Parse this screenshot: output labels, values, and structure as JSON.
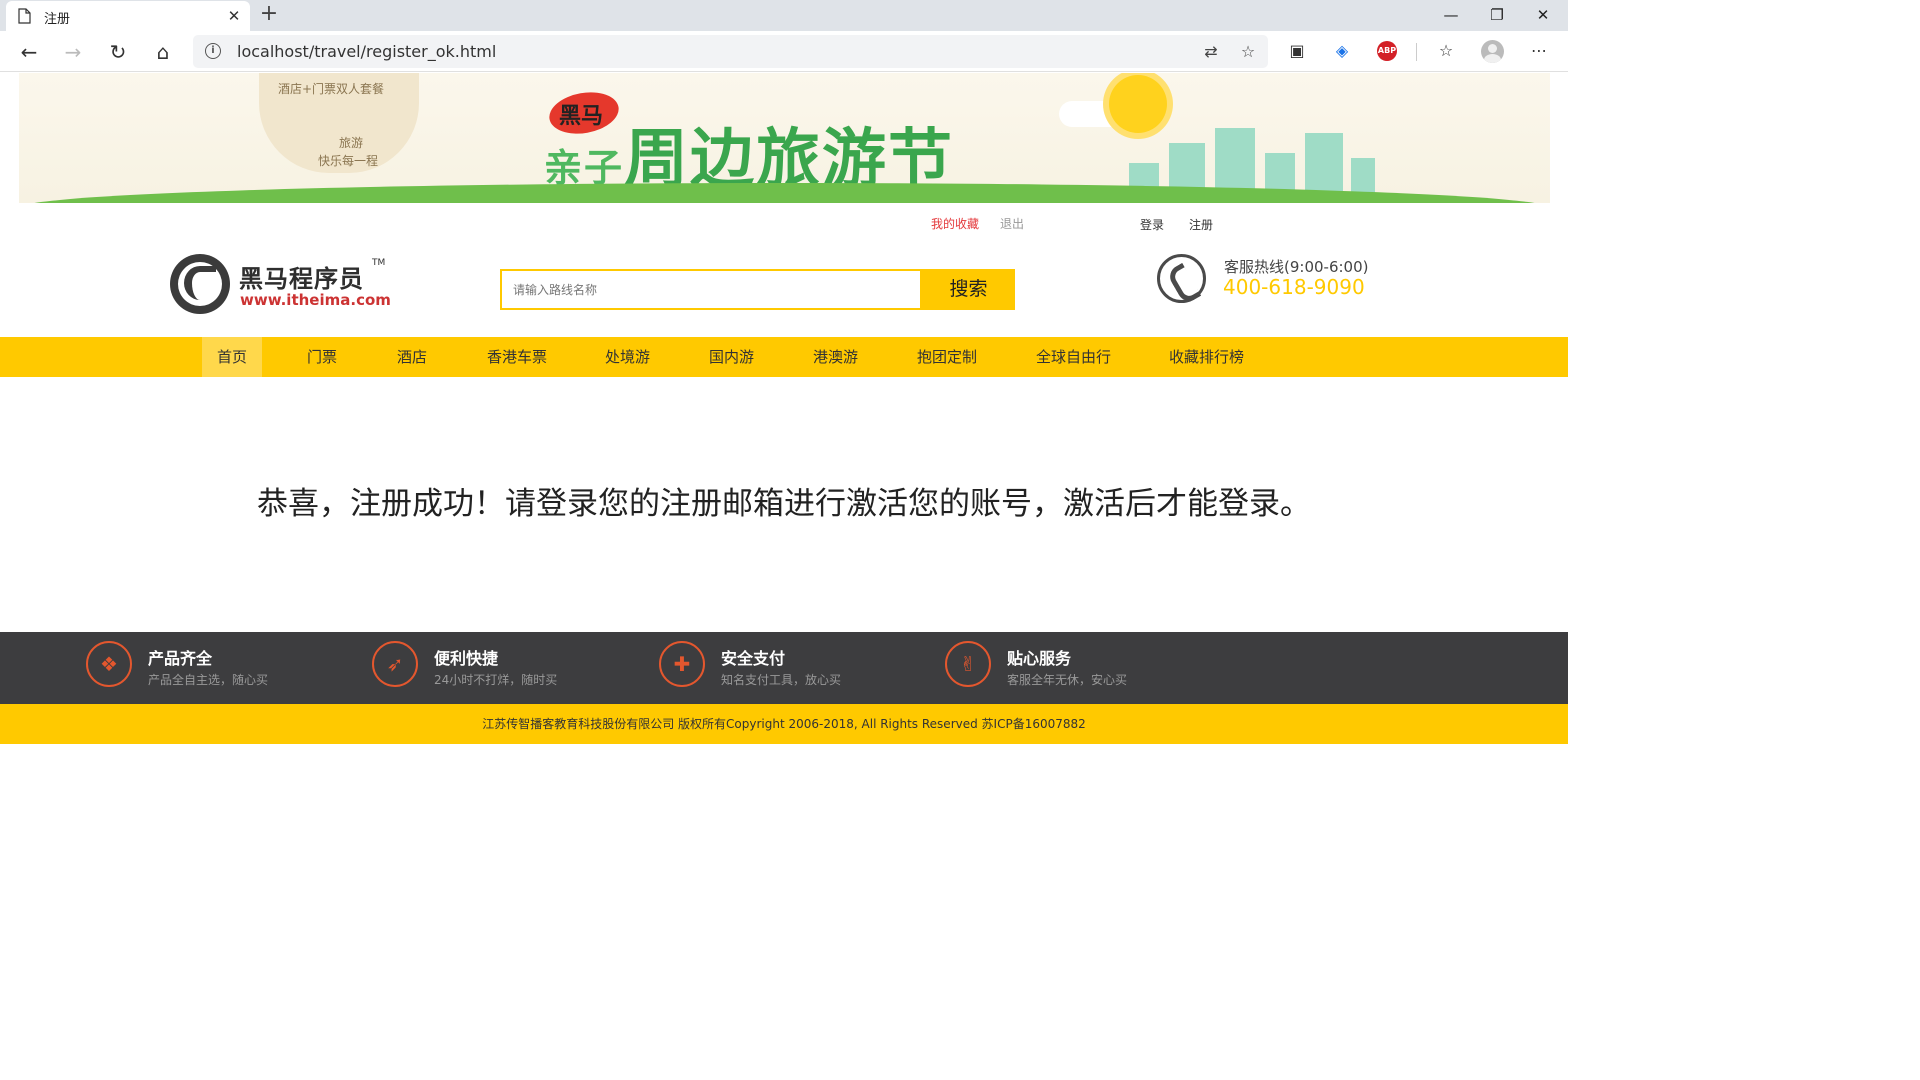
{
  "browser": {
    "tab_title": "注册",
    "url": "localhost/travel/register_ok.html",
    "new_tab_symbol": "+",
    "minimize_symbol": "—",
    "restore_symbol": "❐",
    "close_symbol": "✕",
    "tab_close_symbol": "✕",
    "back_symbol": "←",
    "forward_symbol": "→",
    "reload_symbol": "↻",
    "home_symbol": "⌂",
    "translate_symbol": "⇄",
    "favorite_symbol": "☆",
    "collections_symbol": "▣",
    "extension_symbol": "◈",
    "abp_label": "ABP",
    "favorites_bar_symbol": "☆",
    "more_symbol": "⋯",
    "info_symbol": "i"
  },
  "banner": {
    "bag_line1": "酒店+门票双人套餐",
    "bag_line2": "旅游",
    "bag_line3": "快乐每一程",
    "brand_badge": "黑马",
    "festival_prefix": "亲子",
    "festival_title": "周边旅游节"
  },
  "header": {
    "my_favorites": "我的收藏",
    "logout": "退出",
    "login": "登录",
    "register": "注册",
    "logo_cn": "黑马程序员",
    "logo_tm": "TM",
    "logo_en": "www.itheima.com",
    "search_placeholder": "请输入路线名称",
    "search_button": "搜索",
    "hotline_label": "客服热线(9:00-6:00)",
    "hotline_number": "400-618-9090"
  },
  "nav": {
    "items": [
      "首页",
      "门票",
      "酒店",
      "香港车票",
      "处境游",
      "国内游",
      "港澳游",
      "抱团定制",
      "全球自由行",
      "收藏排行榜"
    ],
    "active_index": 0
  },
  "main": {
    "message": "恭喜，注册成功！请登录您的注册邮箱进行激活您的账号，激活后才能登录。"
  },
  "features": [
    {
      "title": "产品齐全",
      "subtitle": "产品全自主选，随心买",
      "icon": "clover-icon"
    },
    {
      "title": "便利快捷",
      "subtitle": "24小时不打烊，随时买",
      "icon": "rocket-icon"
    },
    {
      "title": "安全支付",
      "subtitle": "知名支付工具，放心买",
      "icon": "shield-icon"
    },
    {
      "title": "贴心服务",
      "subtitle": "客服全年无休，安心买",
      "icon": "thumbs-up-icon"
    }
  ],
  "footer": {
    "copyright": "江苏传智播客教育科技股份有限公司 版权所有Copyright 2006-2018, All Rights Reserved 苏ICP备16007882"
  },
  "colors": {
    "accent": "#ffc900",
    "feature_icon": "#e4572e",
    "footer_dark": "#3d3d3f",
    "favorites_link": "#e4393c"
  }
}
